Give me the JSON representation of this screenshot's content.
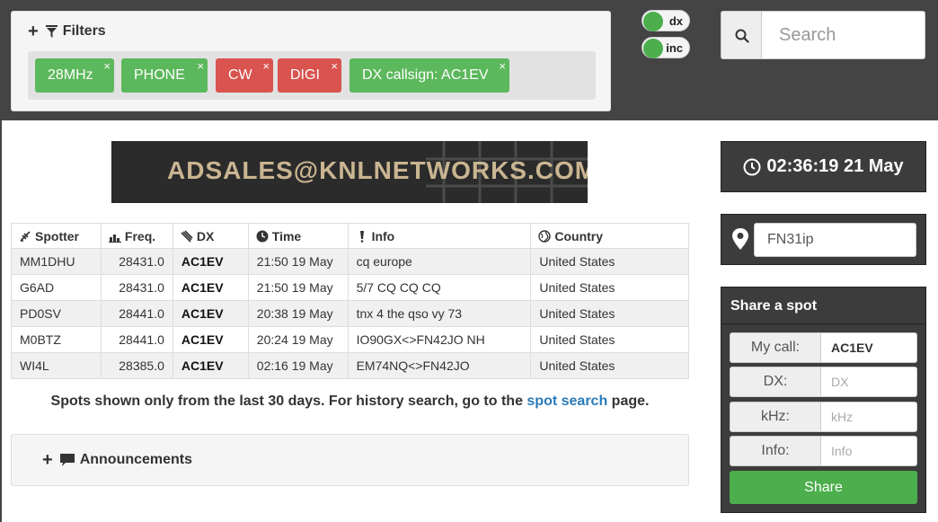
{
  "filters": {
    "title": "Filters",
    "tags": [
      {
        "label": "28MHz",
        "color": "green"
      },
      {
        "label": "PHONE",
        "color": "green"
      },
      {
        "label": "CW",
        "color": "red"
      },
      {
        "label": "DIGI",
        "color": "red"
      },
      {
        "label": "DX callsign: AC1EV",
        "color": "green"
      }
    ],
    "remove_symbol": "×"
  },
  "toggles": {
    "dx": "dx",
    "inc": "inc"
  },
  "search": {
    "placeholder": "Search"
  },
  "ad": {
    "text": "ADSALES@KNLNETWORKS.COM"
  },
  "table": {
    "headers": {
      "spotter": "Spotter",
      "freq": "Freq.",
      "dx": "DX",
      "time": "Time",
      "info": "Info",
      "country": "Country"
    },
    "rows": [
      {
        "spotter": "MM1DHU",
        "freq": "28431.0",
        "dx": "AC1EV",
        "time": "21:50 19 May",
        "info": "cq europe",
        "country": "United States"
      },
      {
        "spotter": "G6AD",
        "freq": "28431.0",
        "dx": "AC1EV",
        "time": "21:50 19 May",
        "info": "5/7 CQ CQ CQ",
        "country": "United States"
      },
      {
        "spotter": "PD0SV",
        "freq": "28441.0",
        "dx": "AC1EV",
        "time": "20:38 19 May",
        "info": "tnx 4 the qso vy 73",
        "country": "United States"
      },
      {
        "spotter": "M0BTZ",
        "freq": "28441.0",
        "dx": "AC1EV",
        "time": "20:24 19 May",
        "info": "IO90GX<>FN42JO NH",
        "country": "United States"
      },
      {
        "spotter": "WI4L",
        "freq": "28385.0",
        "dx": "AC1EV",
        "time": "02:16 19 May",
        "info": "EM74NQ<>FN42JO",
        "country": "United States"
      }
    ]
  },
  "notice": {
    "before": "Spots shown only from the last 30 days. For history search, go to the ",
    "link": "spot search",
    "after": " page."
  },
  "announcements": {
    "title": "Announcements"
  },
  "clock": {
    "time": "02:36:19 21 May"
  },
  "locator": {
    "value": "FN31ip"
  },
  "share": {
    "title": "Share a spot",
    "mycall_label": "My call:",
    "mycall_value": "AC1EV",
    "dx_label": "DX:",
    "dx_placeholder": "DX",
    "khz_label": "kHz:",
    "khz_placeholder": "kHz",
    "info_label": "Info:",
    "info_placeholder": "Info",
    "button": "Share"
  },
  "colors": {
    "topbar": "#444444",
    "green": "#5cb85c",
    "red": "#d9534f",
    "link": "#2a7ab9"
  }
}
